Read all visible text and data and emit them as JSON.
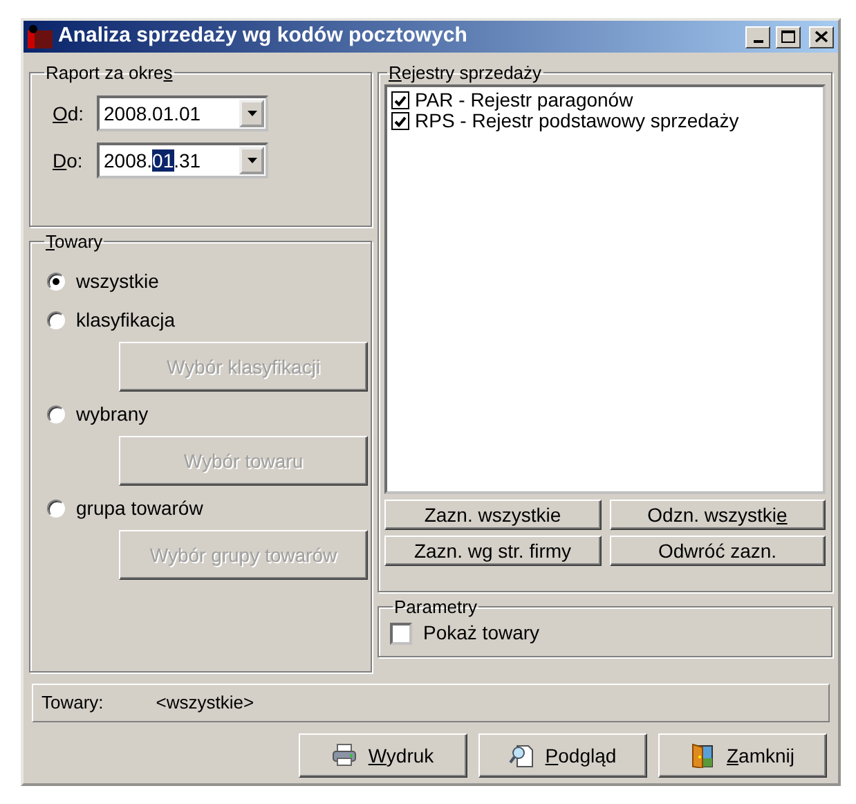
{
  "window": {
    "title": "Analiza sprzedaży wg kodów pocztowych"
  },
  "period": {
    "label": {
      "pre": "Raport za okre",
      "key": "s"
    },
    "fields": [
      {
        "label": {
          "key": "O",
          "post": "d:"
        },
        "value": {
          "pre": "2008.01.01"
        }
      },
      {
        "label": {
          "key": "D",
          "post": "o:"
        },
        "value": {
          "pre": "2008.",
          "selected_text": "01",
          "post": ".31"
        }
      }
    ]
  },
  "goods": {
    "label": {
      "key": "T",
      "post": "owary"
    },
    "options": [
      {
        "label": "wszystkie",
        "selected": true
      },
      {
        "label": "klasyfikacja",
        "selected": false,
        "button": {
          "label": "Wybór klasyfikacji",
          "disabled": true
        }
      },
      {
        "label": "wybrany",
        "selected": false,
        "button": {
          "label": "Wybór towaru",
          "disabled": true
        }
      },
      {
        "label": "grupa towarów",
        "selected": false,
        "button": {
          "label": "Wybór grupy towarów",
          "disabled": true
        }
      }
    ]
  },
  "registers": {
    "label": {
      "key": "R",
      "post": "ejestry sprzedaży"
    },
    "items": [
      {
        "label": "PAR - Rejestr paragonów",
        "checked": true
      },
      {
        "label": "RPS - Rejestr podstawowy sprzedaży",
        "checked": true
      }
    ],
    "buttons": [
      {
        "label": {
          "pre": "Zazn. wszystkie"
        }
      },
      {
        "label": {
          "pre": "Odzn. wszystki",
          "key": "e"
        }
      },
      {
        "label": {
          "pre": "Zazn. wg str. firmy"
        }
      },
      {
        "label": {
          "pre": "Odwróć zazn."
        }
      }
    ]
  },
  "parameters": {
    "label": {
      "pre": "Parametry"
    },
    "options": [
      {
        "label": "Pokaż towary",
        "checked": false
      }
    ]
  },
  "status": {
    "label": "Towary:",
    "value": "<wszystkie>"
  },
  "actions": [
    {
      "label": {
        "key": "W",
        "post": "ydruk"
      }
    },
    {
      "label": {
        "key": "P",
        "post": "odgląd"
      }
    },
    {
      "label": {
        "key": "Z",
        "post": "amknij"
      }
    }
  ]
}
